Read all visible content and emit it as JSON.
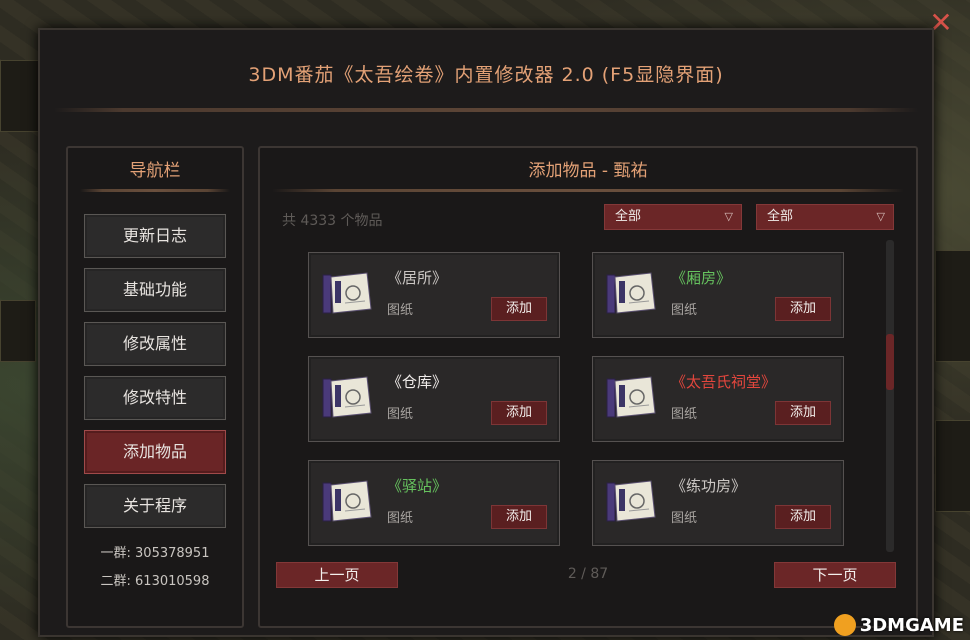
{
  "window": {
    "title": "3DM番茄《太吾绘卷》内置修改器 2.0 (F5显隐界面)"
  },
  "nav": {
    "title": "导航栏",
    "items": [
      {
        "label": "更新日志",
        "active": false
      },
      {
        "label": "基础功能",
        "active": false
      },
      {
        "label": "修改属性",
        "active": false
      },
      {
        "label": "修改特性",
        "active": false
      },
      {
        "label": "添加物品",
        "active": true
      },
      {
        "label": "关于程序",
        "active": false
      }
    ],
    "group1": "一群: 305378951",
    "group2": "二群: 613010598"
  },
  "main": {
    "title": "添加物品 - 甄祐",
    "count": "共 4333 个物品",
    "filter1": "全部",
    "filter2": "全部",
    "items": [
      {
        "name": "《居所》",
        "type": "图纸",
        "button": "添加",
        "color": "#cbc7c4"
      },
      {
        "name": "《厢房》",
        "type": "图纸",
        "button": "添加",
        "color": "#66c25e"
      },
      {
        "name": "《仓库》",
        "type": "图纸",
        "button": "添加",
        "color": "#f0ecea"
      },
      {
        "name": "《太吾氏祠堂》",
        "type": "图纸",
        "button": "添加",
        "color": "#e2463d"
      },
      {
        "name": "《驿站》",
        "type": "图纸",
        "button": "添加",
        "color": "#66c25e"
      },
      {
        "name": "《练功房》",
        "type": "图纸",
        "button": "添加",
        "color": "#cbc7c4"
      }
    ],
    "prev": "上一页",
    "next": "下一页",
    "page": "2 / 87"
  },
  "watermark": "3DMGAME",
  "colors": {
    "accent": "#e3a176",
    "button_red": "#6b2627",
    "rare_green": "#66c25e",
    "rare_red": "#e2463d"
  }
}
